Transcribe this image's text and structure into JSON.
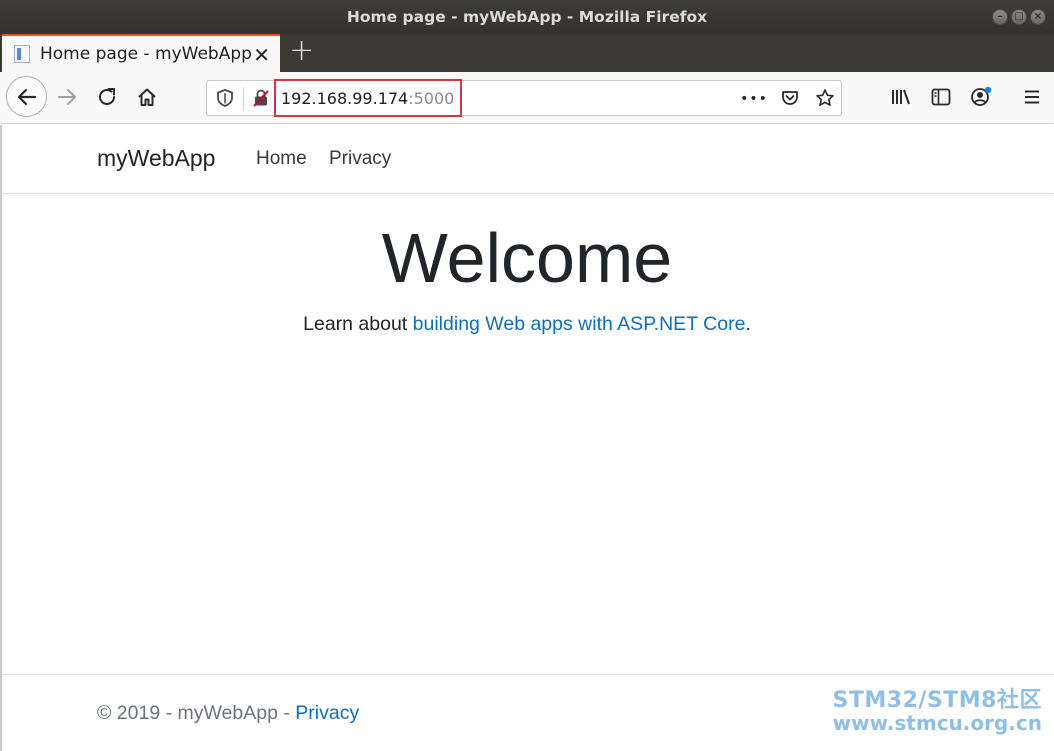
{
  "window": {
    "title": "Home page - myWebApp - Mozilla Firefox",
    "buttons": [
      "minimize-button",
      "maximize-button",
      "close-button"
    ]
  },
  "tab": {
    "label": "Home page - myWebApp",
    "close_glyph": "✕",
    "new_tab_glyph": "+"
  },
  "toolbar": {
    "url_host": "192.168.99.174",
    "url_port": ":5000",
    "page_actions_glyph": "•••"
  },
  "page": {
    "brand": "myWebApp",
    "nav": [
      "Home",
      "Privacy"
    ],
    "heading": "Welcome",
    "learn_prefix": "Learn about ",
    "learn_link": "building Web apps with ASP.NET Core",
    "learn_suffix": ".",
    "footer_prefix": "© 2019 - myWebApp - ",
    "footer_link": "Privacy"
  },
  "watermark": {
    "line1": "STM32/STM8社区",
    "line2": "www.stmcu.org.cn"
  },
  "colors": {
    "accent_tab": "#e95420",
    "link": "#0b6fc2",
    "url_highlight": "#d9363e"
  }
}
